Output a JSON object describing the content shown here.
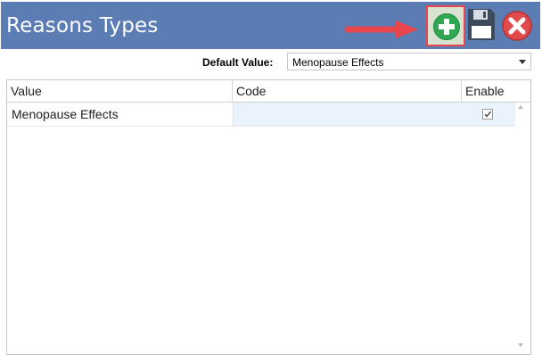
{
  "header": {
    "title": "Reasons Types",
    "accent_color": "#5b7db3",
    "buttons": {
      "add_icon": "plus-icon",
      "save_icon": "floppy-disk-icon",
      "close_icon": "close-icon"
    }
  },
  "annotation": {
    "arrow_color": "#e8454c",
    "highlight_color": "#e8454c"
  },
  "default_value": {
    "label": "Default Value:",
    "selected": "Menopause Effects"
  },
  "grid": {
    "columns": [
      "Value",
      "Code",
      "Enable"
    ],
    "rows": [
      {
        "value": "Menopause Effects",
        "code": "",
        "enable": true
      }
    ]
  }
}
